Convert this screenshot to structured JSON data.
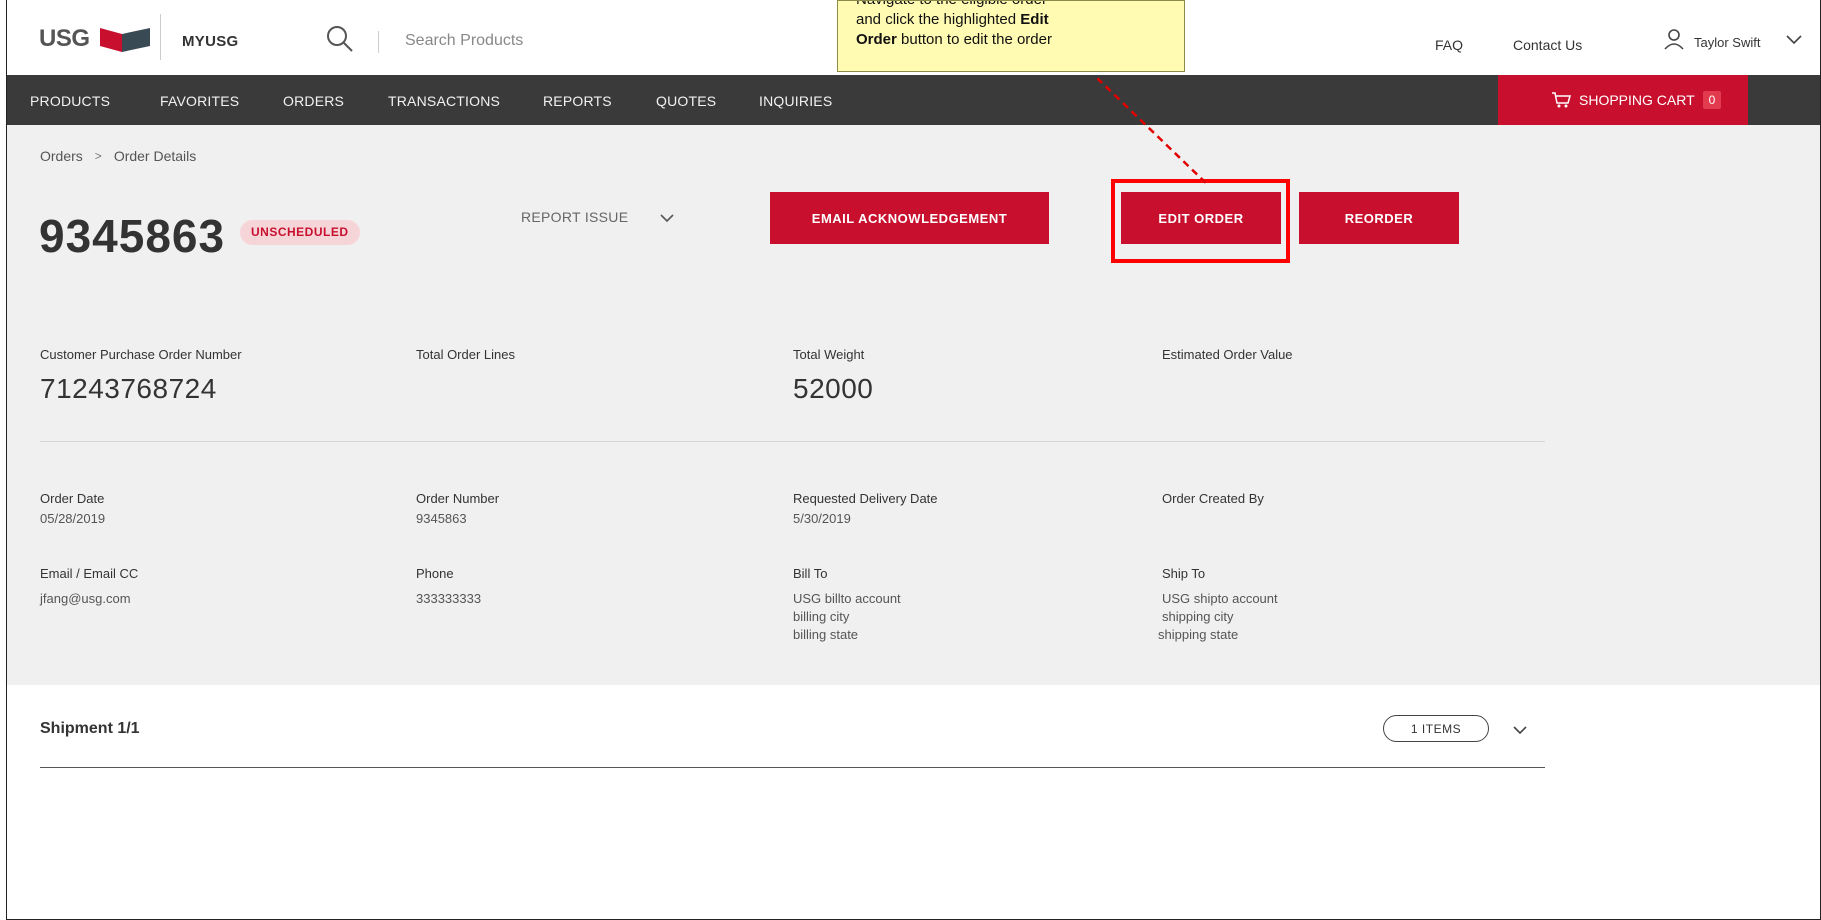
{
  "header": {
    "logo_text": "USG",
    "app_name": "MYUSG",
    "search_placeholder": "Search Products",
    "faq_label": "FAQ",
    "contact_label": "Contact Us",
    "user_name": "Taylor Swift"
  },
  "nav": {
    "items": [
      "PRODUCTS",
      "FAVORITES",
      "ORDERS",
      "TRANSACTIONS",
      "REPORTS",
      "QUOTES",
      "INQUIRIES"
    ],
    "cart_label": "SHOPPING CART",
    "cart_count": "0"
  },
  "breadcrumb": {
    "items": [
      "Orders",
      "Order Details"
    ],
    "separator": ">"
  },
  "order": {
    "number": "9345863",
    "status": "UNSCHEDULED",
    "report_issue_label": "REPORT ISSUE",
    "buttons": {
      "email_ack": "EMAIL ACKNOWLEDGEMENT",
      "edit": "EDIT ORDER",
      "reorder": "REORDER"
    }
  },
  "summary": {
    "po_label": "Customer Purchase Order Number",
    "po_value": "71243768724",
    "lines_label": "Total Order Lines",
    "lines_value": "",
    "weight_label": "Total Weight",
    "weight_value": "52000",
    "value_label": "Estimated Order Value",
    "value_value": ""
  },
  "details": {
    "order_date_label": "Order Date",
    "order_date": "05/28/2019",
    "order_number_label": "Order Number",
    "order_number": "9345863",
    "delivery_label": "Requested Delivery Date",
    "delivery_date": "5/30/2019",
    "created_by_label": "Order Created By",
    "created_by": "",
    "email_label": "Email / Email CC",
    "email": "jfang@usg.com",
    "phone_label": "Phone",
    "phone": "333333333",
    "bill_to_label": "Bill To",
    "bill_to": [
      "USG billto account",
      "billing city",
      "billing state"
    ],
    "ship_to_label": "Ship To",
    "ship_to": [
      "USG shipto account",
      "shipping city",
      "shipping state"
    ]
  },
  "shipment": {
    "title": "Shipment 1/1",
    "items_label": "1 ITEMS"
  },
  "tooltip": {
    "line1": "Navigate to the eligible order",
    "line2_prefix": "and click the highlighted ",
    "line2_bold": "Edit",
    "line3_bold": "Order",
    "line3_suffix": " button to edit the order"
  },
  "colors": {
    "brand_red": "#c8102e",
    "nav_bg": "#3a3a3a",
    "content_bg": "#f0f0f0",
    "badge_bg": "#f6d5d9",
    "tooltip_bg": "#fffbb3",
    "highlight": "#ff0000"
  }
}
